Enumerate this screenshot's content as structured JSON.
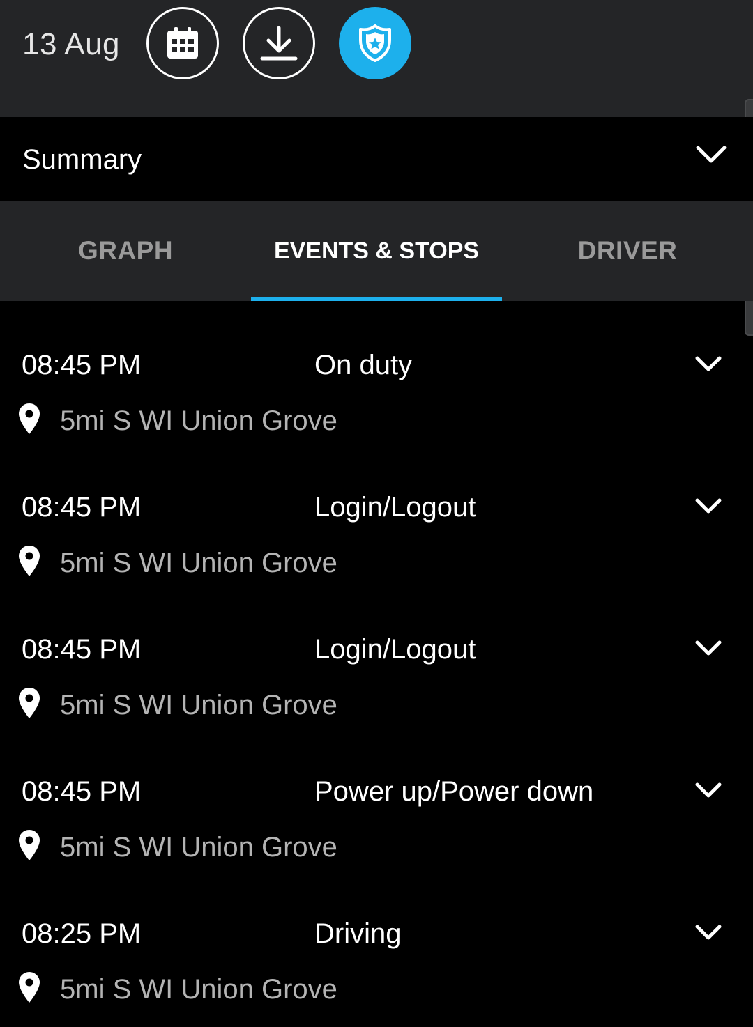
{
  "header": {
    "date": "13 Aug",
    "icons": {
      "calendar": "calendar-icon",
      "download": "download-icon",
      "shield": "shield-badge-icon"
    },
    "accent_color": "#1db0ec"
  },
  "summary": {
    "label": "Summary"
  },
  "tabs": [
    {
      "label": "GRAPH",
      "active": false
    },
    {
      "label": "EVENTS & STOPS",
      "active": true
    },
    {
      "label": "DRIVER",
      "active": false
    }
  ],
  "events": [
    {
      "time": "08:45 PM",
      "type": "On duty",
      "location": "5mi S WI Union Grove"
    },
    {
      "time": "08:45 PM",
      "type": "Login/Logout",
      "location": "5mi S WI Union Grove"
    },
    {
      "time": "08:45 PM",
      "type": "Login/Logout",
      "location": "5mi S WI Union Grove"
    },
    {
      "time": "08:45 PM",
      "type": "Power up/Power down",
      "location": "5mi S WI Union Grove"
    },
    {
      "time": "08:25 PM",
      "type": "Driving",
      "location": "5mi S WI Union Grove"
    }
  ]
}
